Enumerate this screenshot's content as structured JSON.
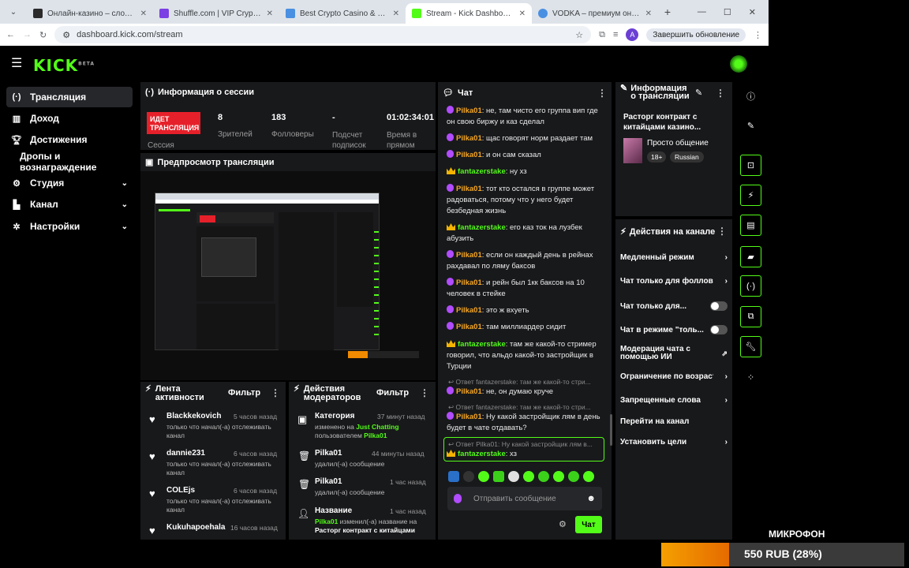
{
  "browser": {
    "tabs": [
      {
        "title": "Онлайн-казино – слоты, лайв",
        "color": "#2b2b2b"
      },
      {
        "title": "Shuffle.com | VIP Crypto Casino",
        "color": "#7b3fe4"
      },
      {
        "title": "Best Crypto Casino & Bitcoin G",
        "color": "#4a90e2"
      },
      {
        "title": "Stream - Kick Dashboard",
        "color": "#53fc18",
        "active": true
      },
      {
        "title": "VODKA – премиум онлайн-ка",
        "color": "#4a90e2"
      }
    ],
    "url": "dashboard.kick.com/stream",
    "update_label": "Завершить обновление",
    "profile_letter": "A"
  },
  "header": {
    "logo": "KICK",
    "logo_sup": "BETA"
  },
  "sidebar": {
    "items": [
      {
        "label": "Трансляция",
        "icon": "broadcast-icon"
      },
      {
        "label": "Доход",
        "icon": "chart-icon"
      },
      {
        "label": "Достижения",
        "icon": "trophy-icon"
      },
      {
        "label": "Дропы и вознаграждение",
        "icon": ""
      },
      {
        "label": "Студия",
        "icon": "studio-icon"
      },
      {
        "label": "Канал",
        "icon": "channel-icon"
      },
      {
        "label": "Настройки",
        "icon": "gear-icon"
      }
    ]
  },
  "session": {
    "title": "Информация о сессии",
    "live_badge": "ИДЕТ ТРАНСЛЯЦИЯ",
    "session_label": "Сессия",
    "stats": [
      {
        "value": "8",
        "label": "Зрителей"
      },
      {
        "value": "183",
        "label": "Фолловеры"
      },
      {
        "value": "-",
        "label": "Подсчет подписок"
      },
      {
        "value": "01:02:34:01",
        "label": "Время в прямом"
      }
    ]
  },
  "preview": {
    "title": "Предпросмотр трансляции"
  },
  "feed": {
    "title": "Лента активности",
    "filter": "Фильтр",
    "items": [
      {
        "name": "Blackkekovich",
        "time": "5 часов назад",
        "text": "только что начал(-а) отслеживать канал"
      },
      {
        "name": "dannie231",
        "time": "6 часов назад",
        "text": "только что начал(-а) отслеживать канал"
      },
      {
        "name": "COLEjs",
        "time": "6 часов назад",
        "text": "только что начал(-а) отслеживать канал"
      },
      {
        "name": "Kukuhapoehala",
        "time": "16 часов назад",
        "text": ""
      }
    ]
  },
  "mod": {
    "title": "Действия модераторов",
    "filter": "Фильтр",
    "items": [
      {
        "name": "Категория",
        "time": "37 минут назад",
        "line1_a": "изменено на ",
        "line1_b": "Just Chatting",
        "line2_a": "пользователем ",
        "line2_b": "Pilka01"
      },
      {
        "name": "Pilka01",
        "time": "44 минуты назад",
        "text": "удалил(-а) сообщение"
      },
      {
        "name": "Pilka01",
        "time": "1 час назад",
        "text": "удалил(-а) сообщение"
      },
      {
        "name": "Название",
        "time": "1 час назад",
        "line1_a": "Pilka01",
        "line1_b": " изменил(-а) название на",
        "line2": "Расторг контракт с китайцами"
      }
    ]
  },
  "chat": {
    "title": "Чат",
    "messages": [
      {
        "user": "Pilka01",
        "type": "p",
        "text": "не, там чисто его группа вип где он свою биржу и каз сделал"
      },
      {
        "user": "Pilka01",
        "type": "p",
        "text": "щас говорят норм раздает там"
      },
      {
        "user": "Pilka01",
        "type": "p",
        "text": "и он сам сказал"
      },
      {
        "user": "fantazerstake",
        "type": "f",
        "text": "ну хз"
      },
      {
        "user": "Pilka01",
        "type": "p",
        "text": "тот кто остался в группе может радоваться, потому что у него будет безбедная жизнь"
      },
      {
        "user": "fantazerstake",
        "type": "f",
        "text": "его каз ток на лузбек абузить"
      },
      {
        "user": "Pilka01",
        "type": "p",
        "text": "если он каждый день в рейнах рахдавал по ляму баксов"
      },
      {
        "user": "Pilka01",
        "type": "p",
        "text": "и рейн был 1кк баксов на 10 человек в стейке"
      },
      {
        "user": "Pilka01",
        "type": "p",
        "text": "это ж вхуеть"
      },
      {
        "user": "Pilka01",
        "type": "p",
        "text": "там миллиардер сидит"
      },
      {
        "user": "fantazerstake",
        "type": "f",
        "text": "там же какой-то стример говорил, что альдо какой-то застройщик в Турции"
      }
    ],
    "reply1": "Ответ fantazerstake: там же какой-то стри...",
    "reply1_user": "Pilka01",
    "reply1_text": "не, он думаю круче",
    "reply2": "Ответ fantazerstake: там же какой-то стри...",
    "reply2_user": "Pilka01",
    "reply2_text": "Ну какой застройщик лям в день будет в чате отдавать?",
    "reply3": "Ответ Pilka01: Ну какой застройщик лям в...",
    "reply3_user": "fantazerstake",
    "reply3_text": "хз",
    "input_placeholder": "Отправить сообщение",
    "send_label": "Чат"
  },
  "stream_info": {
    "title": "Информация о трансляции",
    "stream_title": "Расторг контракт с китайцами казино...",
    "category": "Просто общение",
    "tags": [
      "18+",
      "Russian"
    ]
  },
  "channel_actions": {
    "title": "Действия на канале",
    "items": [
      {
        "label": "Медленный режим",
        "ctrl": "chevron"
      },
      {
        "label": "Чат только для фолловеров",
        "ctrl": "chevron"
      },
      {
        "label": "Чат только для...",
        "ctrl": "toggle"
      },
      {
        "label": "Чат в режиме \"толь...",
        "ctrl": "toggle"
      },
      {
        "label": "Модерация чата с помощью ИИ",
        "ctrl": "external"
      },
      {
        "label": "Ограничение по возрасту",
        "ctrl": "chevron"
      },
      {
        "label": "Запрещенные слова",
        "ctrl": "chevron"
      },
      {
        "label": "Перейти на канал",
        "ctrl": "none"
      },
      {
        "label": "Установить цели",
        "ctrl": "chevron"
      }
    ]
  },
  "overlay": {
    "mic_label": "МИКРОФОН",
    "goal_text": "550 RUB (28%)",
    "goal_progress": 0.28
  }
}
